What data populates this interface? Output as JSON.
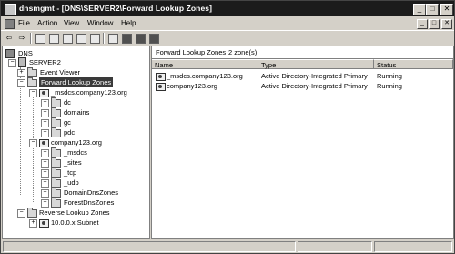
{
  "window": {
    "title": "dnsmgmt - [DNS\\SERVER2\\Forward Lookup Zones]"
  },
  "title_buttons": [
    "_",
    "□",
    "✕"
  ],
  "menu": {
    "items": [
      "File",
      "Action",
      "View",
      "Window",
      "Help"
    ],
    "mdi_buttons": [
      "_",
      "□",
      "✕"
    ]
  },
  "toolbar": {
    "icons": [
      "back-icon",
      "forward-icon",
      "up-folder-icon",
      "show-hide-tree-icon",
      "refresh-icon",
      "export-icon",
      "properties-icon",
      "help-icon",
      "server-icon",
      "new-zone-icon",
      "new-record-icon"
    ]
  },
  "tree": {
    "root": "DNS",
    "server": "SERVER2",
    "event_viewer": "Event Viewer",
    "forward": "Forward Lookup Zones",
    "msdcs_zone": "_msdcs.company123.org",
    "msdcs_children": [
      "dc",
      "domains",
      "gc",
      "pdc"
    ],
    "company_zone": "company123.org",
    "company_children": [
      "_msdcs",
      "_sites",
      "_tcp",
      "_udp",
      "DomainDnsZones",
      "ForestDnsZones"
    ],
    "reverse": "Reverse Lookup Zones",
    "subnet": "10.0.0.x Subnet"
  },
  "right": {
    "header_title": "Forward Lookup Zones",
    "header_count": "2 zone(s)",
    "columns": [
      "Name",
      "Type",
      "Status"
    ],
    "rows": [
      {
        "name": "_msdcs.company123.org",
        "type": "Active Directory-Integrated Primary",
        "status": "Running"
      },
      {
        "name": "company123.org",
        "type": "Active Directory-Integrated Primary",
        "status": "Running"
      }
    ]
  }
}
